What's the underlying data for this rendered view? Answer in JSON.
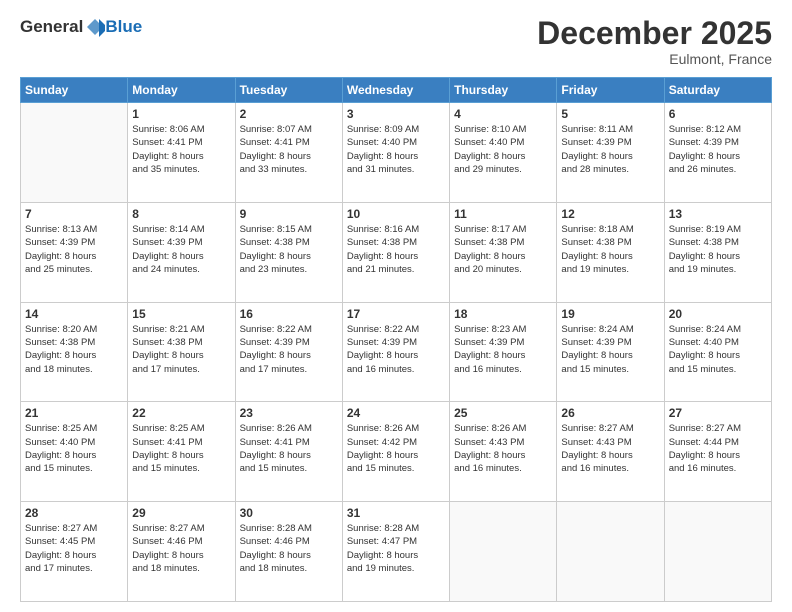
{
  "header": {
    "logo_general": "General",
    "logo_blue": "Blue",
    "month": "December 2025",
    "location": "Eulmont, France"
  },
  "days_of_week": [
    "Sunday",
    "Monday",
    "Tuesday",
    "Wednesday",
    "Thursday",
    "Friday",
    "Saturday"
  ],
  "weeks": [
    [
      {
        "day": "",
        "info": ""
      },
      {
        "day": "1",
        "info": "Sunrise: 8:06 AM\nSunset: 4:41 PM\nDaylight: 8 hours\nand 35 minutes."
      },
      {
        "day": "2",
        "info": "Sunrise: 8:07 AM\nSunset: 4:41 PM\nDaylight: 8 hours\nand 33 minutes."
      },
      {
        "day": "3",
        "info": "Sunrise: 8:09 AM\nSunset: 4:40 PM\nDaylight: 8 hours\nand 31 minutes."
      },
      {
        "day": "4",
        "info": "Sunrise: 8:10 AM\nSunset: 4:40 PM\nDaylight: 8 hours\nand 29 minutes."
      },
      {
        "day": "5",
        "info": "Sunrise: 8:11 AM\nSunset: 4:39 PM\nDaylight: 8 hours\nand 28 minutes."
      },
      {
        "day": "6",
        "info": "Sunrise: 8:12 AM\nSunset: 4:39 PM\nDaylight: 8 hours\nand 26 minutes."
      }
    ],
    [
      {
        "day": "7",
        "info": "Sunrise: 8:13 AM\nSunset: 4:39 PM\nDaylight: 8 hours\nand 25 minutes."
      },
      {
        "day": "8",
        "info": "Sunrise: 8:14 AM\nSunset: 4:39 PM\nDaylight: 8 hours\nand 24 minutes."
      },
      {
        "day": "9",
        "info": "Sunrise: 8:15 AM\nSunset: 4:38 PM\nDaylight: 8 hours\nand 23 minutes."
      },
      {
        "day": "10",
        "info": "Sunrise: 8:16 AM\nSunset: 4:38 PM\nDaylight: 8 hours\nand 21 minutes."
      },
      {
        "day": "11",
        "info": "Sunrise: 8:17 AM\nSunset: 4:38 PM\nDaylight: 8 hours\nand 20 minutes."
      },
      {
        "day": "12",
        "info": "Sunrise: 8:18 AM\nSunset: 4:38 PM\nDaylight: 8 hours\nand 19 minutes."
      },
      {
        "day": "13",
        "info": "Sunrise: 8:19 AM\nSunset: 4:38 PM\nDaylight: 8 hours\nand 19 minutes."
      }
    ],
    [
      {
        "day": "14",
        "info": "Sunrise: 8:20 AM\nSunset: 4:38 PM\nDaylight: 8 hours\nand 18 minutes."
      },
      {
        "day": "15",
        "info": "Sunrise: 8:21 AM\nSunset: 4:38 PM\nDaylight: 8 hours\nand 17 minutes."
      },
      {
        "day": "16",
        "info": "Sunrise: 8:22 AM\nSunset: 4:39 PM\nDaylight: 8 hours\nand 17 minutes."
      },
      {
        "day": "17",
        "info": "Sunrise: 8:22 AM\nSunset: 4:39 PM\nDaylight: 8 hours\nand 16 minutes."
      },
      {
        "day": "18",
        "info": "Sunrise: 8:23 AM\nSunset: 4:39 PM\nDaylight: 8 hours\nand 16 minutes."
      },
      {
        "day": "19",
        "info": "Sunrise: 8:24 AM\nSunset: 4:39 PM\nDaylight: 8 hours\nand 15 minutes."
      },
      {
        "day": "20",
        "info": "Sunrise: 8:24 AM\nSunset: 4:40 PM\nDaylight: 8 hours\nand 15 minutes."
      }
    ],
    [
      {
        "day": "21",
        "info": "Sunrise: 8:25 AM\nSunset: 4:40 PM\nDaylight: 8 hours\nand 15 minutes."
      },
      {
        "day": "22",
        "info": "Sunrise: 8:25 AM\nSunset: 4:41 PM\nDaylight: 8 hours\nand 15 minutes."
      },
      {
        "day": "23",
        "info": "Sunrise: 8:26 AM\nSunset: 4:41 PM\nDaylight: 8 hours\nand 15 minutes."
      },
      {
        "day": "24",
        "info": "Sunrise: 8:26 AM\nSunset: 4:42 PM\nDaylight: 8 hours\nand 15 minutes."
      },
      {
        "day": "25",
        "info": "Sunrise: 8:26 AM\nSunset: 4:43 PM\nDaylight: 8 hours\nand 16 minutes."
      },
      {
        "day": "26",
        "info": "Sunrise: 8:27 AM\nSunset: 4:43 PM\nDaylight: 8 hours\nand 16 minutes."
      },
      {
        "day": "27",
        "info": "Sunrise: 8:27 AM\nSunset: 4:44 PM\nDaylight: 8 hours\nand 16 minutes."
      }
    ],
    [
      {
        "day": "28",
        "info": "Sunrise: 8:27 AM\nSunset: 4:45 PM\nDaylight: 8 hours\nand 17 minutes."
      },
      {
        "day": "29",
        "info": "Sunrise: 8:27 AM\nSunset: 4:46 PM\nDaylight: 8 hours\nand 18 minutes."
      },
      {
        "day": "30",
        "info": "Sunrise: 8:28 AM\nSunset: 4:46 PM\nDaylight: 8 hours\nand 18 minutes."
      },
      {
        "day": "31",
        "info": "Sunrise: 8:28 AM\nSunset: 4:47 PM\nDaylight: 8 hours\nand 19 minutes."
      },
      {
        "day": "",
        "info": ""
      },
      {
        "day": "",
        "info": ""
      },
      {
        "day": "",
        "info": ""
      }
    ]
  ]
}
